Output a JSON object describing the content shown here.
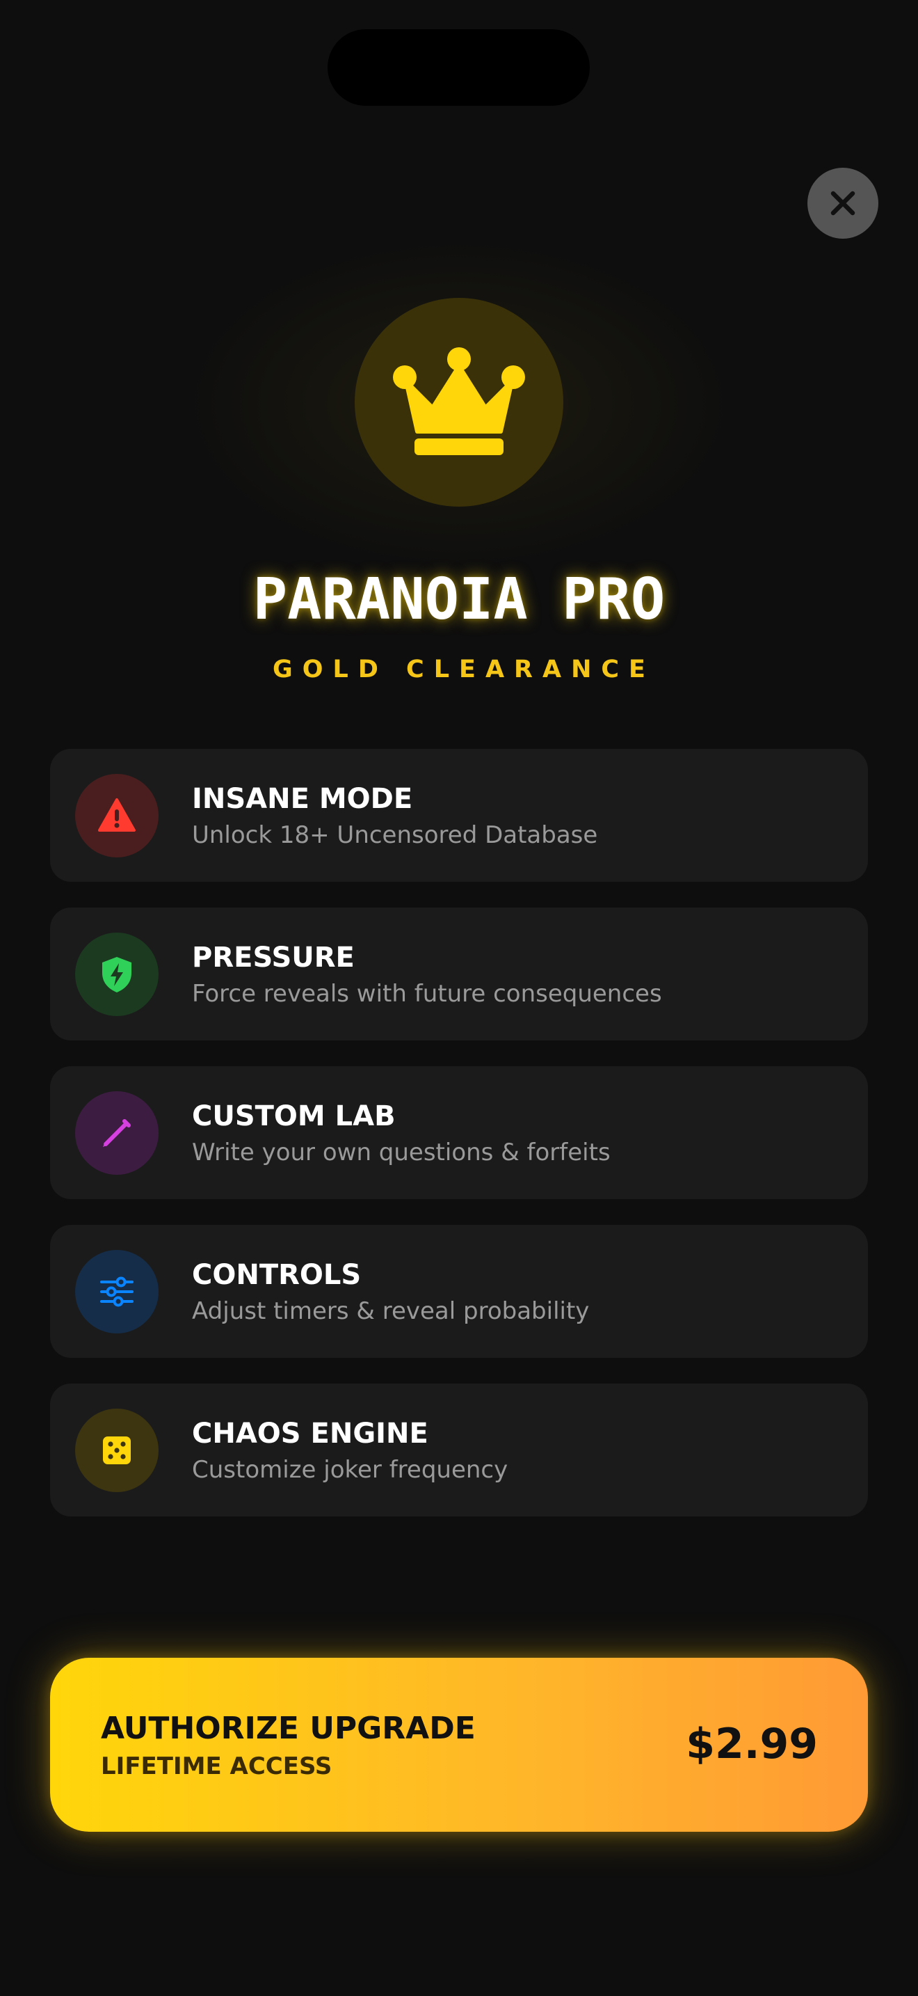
{
  "header": {
    "close_icon": "close-icon"
  },
  "hero": {
    "icon": "crown-icon",
    "title": "PARANOIA PRO",
    "subtitle": "GOLD CLEARANCE"
  },
  "features": [
    {
      "icon": "warning-triangle-icon",
      "title": "INSANE MODE",
      "description": "Unlock 18+ Uncensored Database",
      "accent": "#ff3b30"
    },
    {
      "icon": "shield-bolt-icon",
      "title": "PRESSURE",
      "description": "Force reveals with future consequences",
      "accent": "#30d158"
    },
    {
      "icon": "pencil-icon",
      "title": "CUSTOM LAB",
      "description": "Write your own questions & forfeits",
      "accent": "#d63fe0"
    },
    {
      "icon": "sliders-icon",
      "title": "CONTROLS",
      "description": "Adjust timers & reveal probability",
      "accent": "#0a84ff"
    },
    {
      "icon": "dice-icon",
      "title": "CHAOS ENGINE",
      "description": "Customize joker frequency",
      "accent": "#ffd60a"
    }
  ],
  "cta": {
    "title": "AUTHORIZE UPGRADE",
    "subtitle": "LIFETIME ACCESS",
    "price": "$2.99"
  },
  "colors": {
    "background": "#0e0e0e",
    "gold": "#ffd60a",
    "card": "#1b1b1b",
    "cta_gradient_start": "#ffd60a",
    "cta_gradient_end": "#ff9a35"
  }
}
